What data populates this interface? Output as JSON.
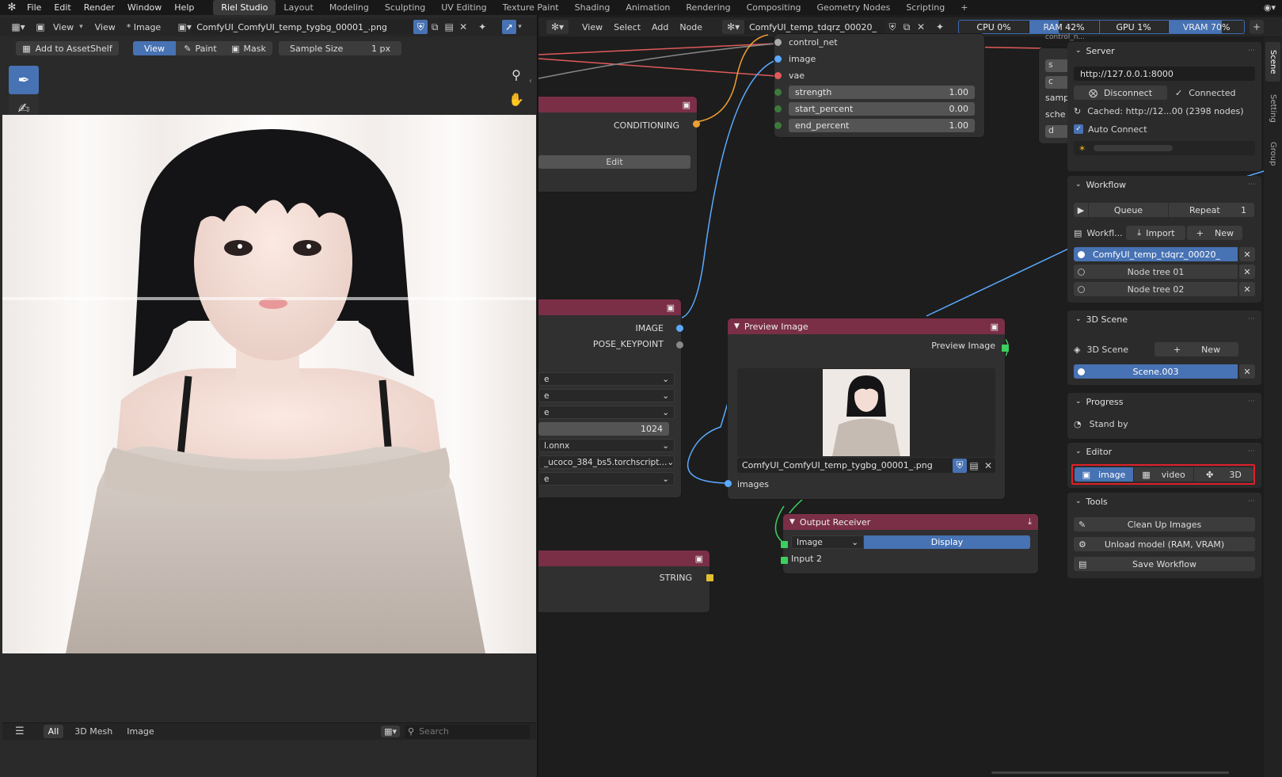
{
  "topbar": {
    "menus": [
      "File",
      "Edit",
      "Render",
      "Window",
      "Help"
    ],
    "workspaces": [
      "Riel Studio",
      "Layout",
      "Modeling",
      "Sculpting",
      "UV Editing",
      "Texture Paint",
      "Shading",
      "Animation",
      "Rendering",
      "Compositing",
      "Geometry Nodes",
      "Scripting"
    ],
    "active_workspace": "Riel Studio",
    "add_icon": "+"
  },
  "image_editor": {
    "view_menu": "View",
    "view2": "View",
    "image_menu": "* Image",
    "image_name": "ComfyUI_ComfyUI_temp_tygbg_00001_.png",
    "add_to_assetshelf": "Add to AssetShelf",
    "mode_view": "View",
    "mode_paint": "Paint",
    "mode_mask": "Mask",
    "sample_size_label": "Sample Size",
    "sample_size_value": "1 px"
  },
  "asset_shelf": {
    "tabs": [
      "All",
      "3D Mesh",
      "Image"
    ],
    "active_tab": "All",
    "search_placeholder": "Search"
  },
  "node_editor": {
    "menus": [
      "View",
      "Select",
      "Add",
      "Node"
    ],
    "tree_name": "ComfyUI_temp_tdqrz_00020_",
    "stats": {
      "cpu": "CPU 0%",
      "ram": "RAM 42%",
      "gpu": "GPU 1%",
      "vram": "VRAM 70%"
    },
    "stats_fill": {
      "cpu": 0,
      "ram": 42,
      "gpu": 1,
      "vram": 70
    }
  },
  "nodes": {
    "controlnet": {
      "inputs": [
        "control_net",
        "image",
        "vae"
      ],
      "strength_label": "strength",
      "strength_value": "1.00",
      "start_label": "start_percent",
      "start_value": "0.00",
      "end_label": "end_percent",
      "end_value": "1.00"
    },
    "cond": {
      "output": "CONDITIONING",
      "edit": "Edit"
    },
    "pose": {
      "out_image": "IMAGE",
      "out_pose": "POSE_KEYPOINT",
      "dd1": "e",
      "dd2": "e",
      "dd3": "e",
      "res": "1024",
      "dd5": "l.onnx",
      "dd6": "_ucoco_384_bs5.torchscript...",
      "dd7": "e"
    },
    "preview": {
      "title": "Preview Image",
      "output": "Preview Image",
      "filename": "ComfyUI_ComfyUI_temp_tygbg_00001_.png",
      "input": "images"
    },
    "output_receiver": {
      "title": "Output Receiver",
      "type": "Image",
      "display": "Display",
      "input2": "Input 2"
    },
    "string_node": {
      "output": "STRING"
    },
    "partial": {
      "s1": "s",
      "s2": "c",
      "s3": "samp",
      "s4": "sche",
      "s5": "d",
      "s6": "control_n..."
    }
  },
  "sidebar_tabs": [
    "Scene",
    "Setting",
    "Group"
  ],
  "server": {
    "title": "Server",
    "url": "http://127.0.0.1:8000",
    "disconnect": "Disconnect",
    "connected": "Connected",
    "cached": "Cached: http://12...00  (2398 nodes)",
    "auto_connect": "Auto Connect"
  },
  "workflow": {
    "title": "Workflow",
    "queue": "Queue",
    "repeat": "Repeat",
    "repeat_count": "1",
    "workflow_label": "Workfl...",
    "import": "Import",
    "new": "New",
    "items": [
      "ComfyUI_temp_tdqrz_00020_",
      "Node tree 01",
      "Node tree 02"
    ]
  },
  "scene3d": {
    "title": "3D Scene",
    "label": "3D Scene",
    "new": "New",
    "scene": "Scene.003"
  },
  "progress": {
    "title": "Progress",
    "status": "Stand by"
  },
  "editor": {
    "title": "Editor",
    "image": "image",
    "video": "video",
    "three_d": "3D"
  },
  "tools": {
    "title": "Tools",
    "clean": "Clean Up Images",
    "unload": "Unload model (RAM, VRAM)",
    "save": "Save Workflow"
  },
  "colors": {
    "node_header": "#7a2f47",
    "accent_blue": "#4772b3",
    "highlight_red": "#e0202a"
  }
}
